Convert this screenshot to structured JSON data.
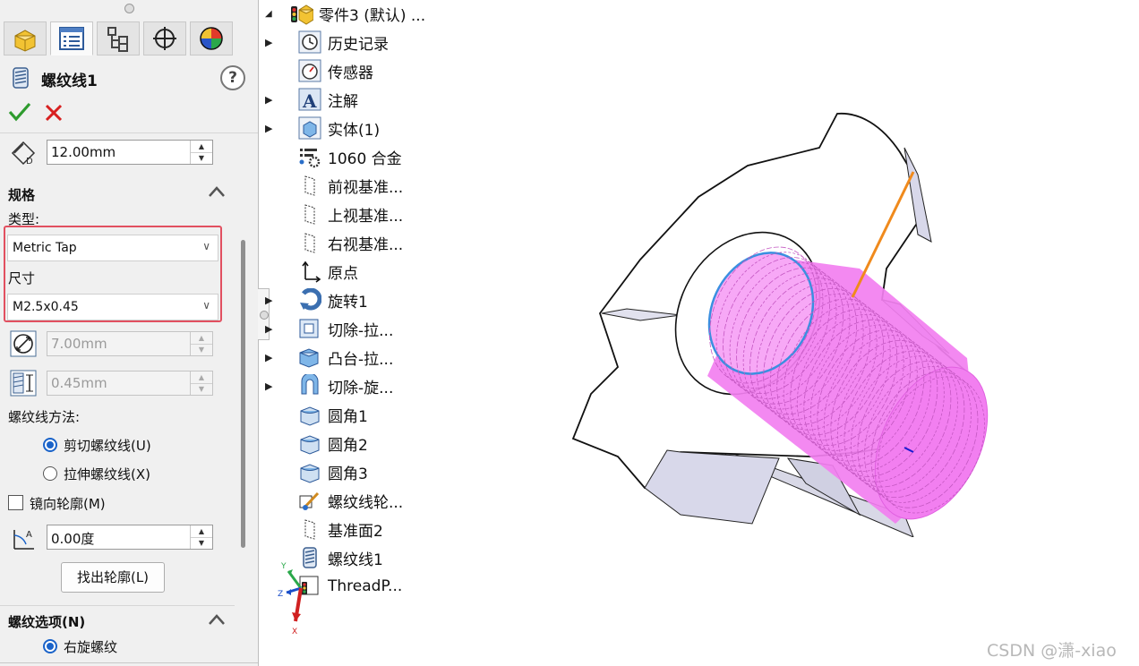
{
  "property_manager": {
    "tabs": [
      {
        "name": "feature-manager-tab",
        "icon": "part-icon"
      },
      {
        "name": "property-manager-tab",
        "icon": "property-list-icon"
      },
      {
        "name": "configuration-manager-tab",
        "icon": "configuration-icon"
      },
      {
        "name": "dimxpert-tab",
        "icon": "crosshair-icon"
      },
      {
        "name": "display-manager-tab",
        "icon": "appearance-sphere-icon"
      }
    ],
    "title": "螺纹线1",
    "help_label": "?",
    "offset_value": "12.00mm",
    "spec_section": "规格",
    "type_label": "类型:",
    "type_value": "Metric Tap",
    "size_label": "尺寸",
    "size_value": "M2.5x0.45",
    "diameter_value": "7.00mm",
    "pitch_value": "0.45mm",
    "method_label": "螺纹线方法:",
    "method_cut": "剪切螺纹线(U)",
    "method_extrude": "拉伸螺纹线(X)",
    "mirror_label": "镜向轮廓(M)",
    "angle_value": "0.00度",
    "find_profile_button": "找出轮廓(L)",
    "options_section": "螺纹选项(N)",
    "right_hand_label": "右旋螺纹"
  },
  "tree": {
    "root": "零件3 (默认) ...",
    "items": [
      {
        "label": "历史记录",
        "expandable": true,
        "icon": "history-icon"
      },
      {
        "label": "传感器",
        "expandable": false,
        "icon": "sensor-icon"
      },
      {
        "label": "注解",
        "expandable": true,
        "icon": "annotation-icon"
      },
      {
        "label": "实体(1)",
        "expandable": true,
        "icon": "solid-bodies-icon"
      },
      {
        "label": "1060 合金",
        "expandable": false,
        "icon": "material-icon"
      },
      {
        "label": "前视基准...",
        "expandable": false,
        "icon": "plane-icon"
      },
      {
        "label": "上视基准...",
        "expandable": false,
        "icon": "plane-icon"
      },
      {
        "label": "右视基准...",
        "expandable": false,
        "icon": "plane-icon"
      },
      {
        "label": "原点",
        "expandable": false,
        "icon": "origin-icon"
      },
      {
        "label": "旋转1",
        "expandable": true,
        "icon": "revolve-icon"
      },
      {
        "label": "切除-拉...",
        "expandable": true,
        "icon": "cut-extrude-icon"
      },
      {
        "label": "凸台-拉...",
        "expandable": true,
        "icon": "boss-extrude-icon"
      },
      {
        "label": "切除-旋...",
        "expandable": true,
        "icon": "cut-revolve-icon"
      },
      {
        "label": "圆角1",
        "expandable": false,
        "icon": "fillet-icon"
      },
      {
        "label": "圆角2",
        "expandable": false,
        "icon": "fillet-icon"
      },
      {
        "label": "圆角3",
        "expandable": false,
        "icon": "fillet-icon"
      },
      {
        "label": "螺纹线轮...",
        "expandable": false,
        "icon": "thread-profile-sketch-icon"
      },
      {
        "label": "基准面2",
        "expandable": false,
        "icon": "plane-icon"
      },
      {
        "label": "螺纹线1",
        "expandable": false,
        "icon": "thread-icon"
      },
      {
        "label": "ThreadP...",
        "expandable": false,
        "icon": "thread-sketch-icon"
      }
    ]
  },
  "triad": {
    "x": "X",
    "y": "Y",
    "z": "Z"
  },
  "watermark": "CSDN @潇-xiao",
  "colors": {
    "thread_highlight": "#f27ff0",
    "highlight_box": "#e25060",
    "accept": "#2e9b2e",
    "cancel": "#d82020",
    "edge_orange": "#f08a1c",
    "edge_blue": "#3a8fe0"
  }
}
